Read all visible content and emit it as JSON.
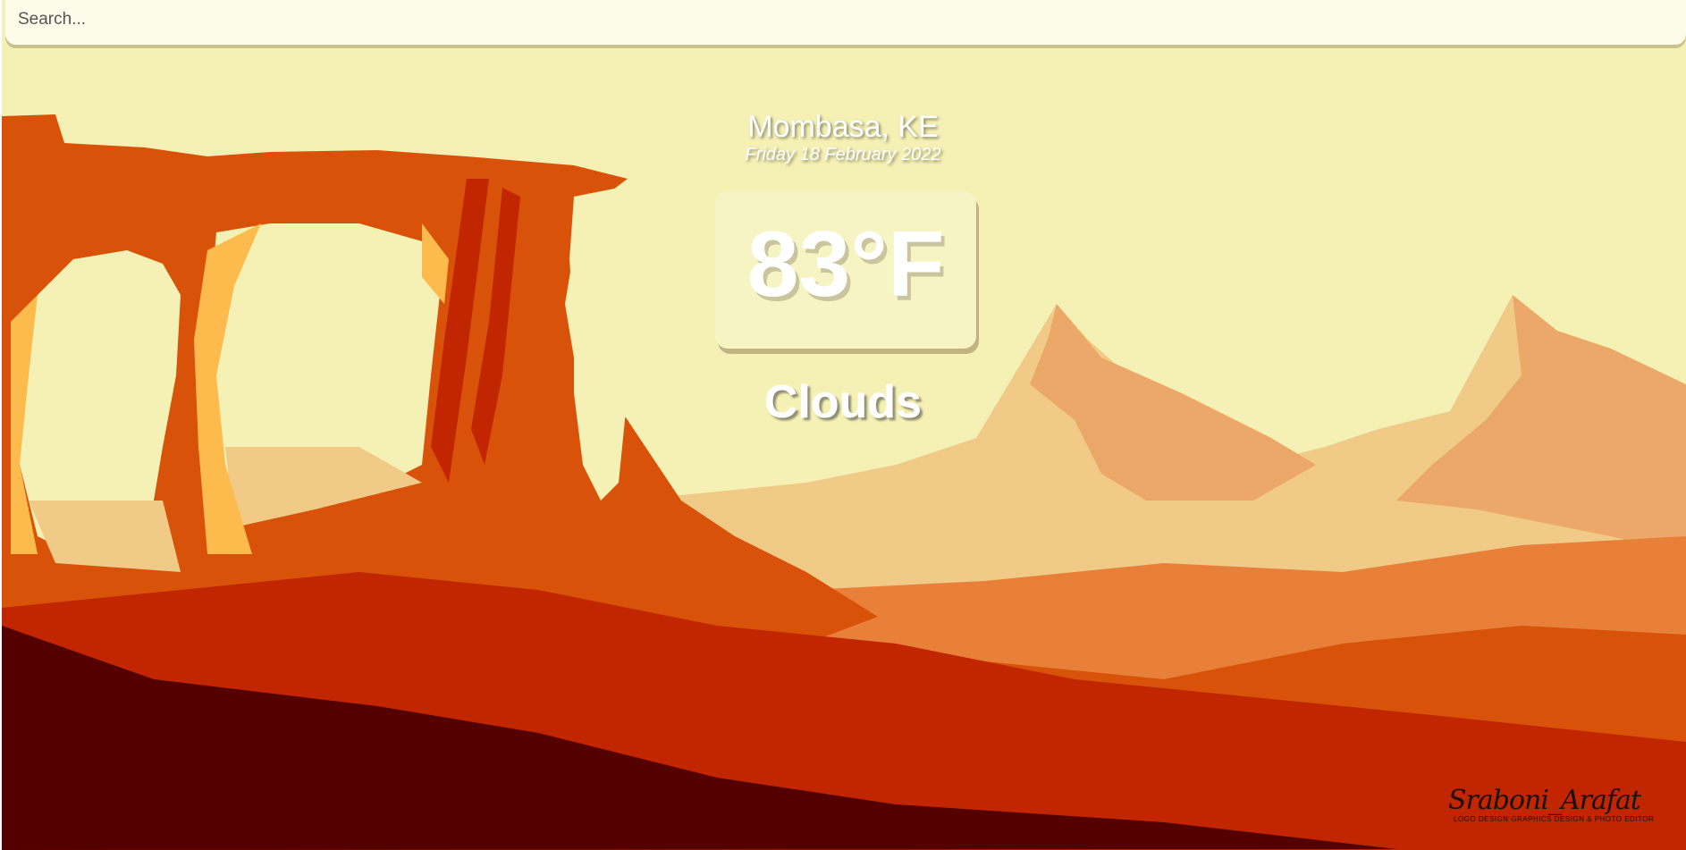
{
  "search": {
    "placeholder": "Search...",
    "value": ""
  },
  "weather": {
    "location": "Mombasa, KE",
    "date": "Friday 18 February 2022",
    "temperature": "83°F",
    "condition": "Clouds"
  },
  "signature": {
    "name": "Sraboni_Arafat",
    "tagline": "LOGO DESIGN GRAPHICS DESIGN & PHOTO EDITOR"
  },
  "colors": {
    "sky": "#f5f1b4",
    "rock_dark": "#550000",
    "rock_red": "#c12600",
    "rock_orange": "#d9520a",
    "rock_light": "#e8803a",
    "sand": "#f0ca86"
  }
}
